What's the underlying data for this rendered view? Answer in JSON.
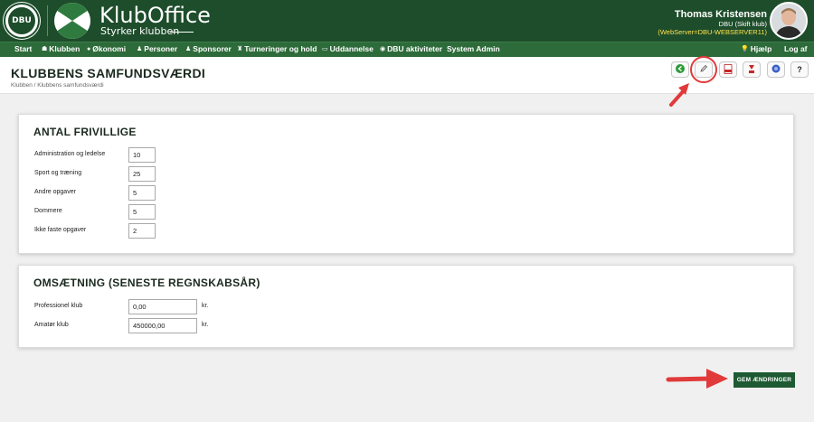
{
  "app": {
    "logo_text": "DBU",
    "brand": "KlubOffice",
    "tagline": "Styrker klubben"
  },
  "user": {
    "name": "Thomas Kristensen",
    "club": "DBU (Skift klub)",
    "server": "(WebServer=DBU-WEBSERVER11)"
  },
  "nav": {
    "items": [
      {
        "label": "Start",
        "icon": ""
      },
      {
        "label": "Klubben",
        "icon": "users-icon"
      },
      {
        "label": "Økonomi",
        "icon": "coins-icon"
      },
      {
        "label": "Personer",
        "icon": "person-icon"
      },
      {
        "label": "Sponsorer",
        "icon": "group-icon"
      },
      {
        "label": "Turneringer og hold",
        "icon": "trophy-icon"
      },
      {
        "label": "Uddannelse",
        "icon": "monitor-icon"
      },
      {
        "label": "DBU aktiviteter",
        "icon": "football-icon"
      },
      {
        "label": "System Admin",
        "icon": ""
      }
    ],
    "help": "Hjælp",
    "logout": "Log af"
  },
  "page": {
    "title": "KLUBBENS SAMFUNDSVÆRDI",
    "breadcrumb": "Klubben / Klubbens samfundsværdi"
  },
  "toolbar": {
    "icons": [
      "back-icon",
      "edit-icon",
      "pdf-icon",
      "pdf-export-icon",
      "info-icon",
      "help-icon"
    ],
    "help_label": "?"
  },
  "volunteers": {
    "title": "ANTAL FRIVILLIGE",
    "fields": [
      {
        "label": "Administration og ledelse",
        "value": "10"
      },
      {
        "label": "Sport og træning",
        "value": "25"
      },
      {
        "label": "Andre opgaver",
        "value": "5"
      },
      {
        "label": "Dommere",
        "value": "5"
      },
      {
        "label": "Ikke faste opgaver",
        "value": "2"
      }
    ]
  },
  "revenue": {
    "title": "OMSÆTNING (SENESTE REGNSKABSÅR)",
    "fields": [
      {
        "label": "Professionel klub",
        "value": "0,00",
        "unit": "kr."
      },
      {
        "label": "Amatør klub",
        "value": "450000,00",
        "unit": "kr."
      }
    ]
  },
  "actions": {
    "save": "GEM ÆNDRINGER"
  },
  "colors": {
    "header_bg": "#1e4d2b",
    "nav_bg": "#2d6b3a",
    "accent_red": "#e03a3a",
    "save_bg": "#1e5a32",
    "server_text": "#ffe14d"
  }
}
